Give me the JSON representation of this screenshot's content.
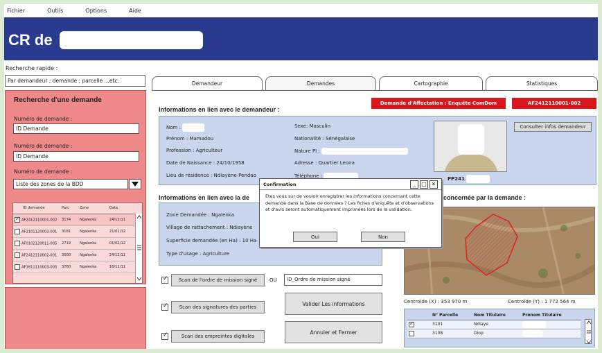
{
  "menu": [
    "Fichier",
    "Outils",
    "Options",
    "Aide"
  ],
  "header": {
    "title": "CR de"
  },
  "quick_search": {
    "label": "Recherche rapide :",
    "value": "Par demandeur ; demande ; parcelle ...etc."
  },
  "left": {
    "title": "Recherche d'une demande",
    "field1_label": "Numéro de demande :",
    "field1_value": "ID Demande",
    "field2_label": "Numéro de demande :",
    "field2_value": "ID Demande",
    "field3_label": "Numéro de demande :",
    "field3_value": "Liste des zones de la BDD",
    "grid_headers": [
      "ID demande",
      "Parc",
      "Zone",
      "Date"
    ],
    "grid_rows": [
      {
        "id": "AF2412110001-002",
        "parc": "3174",
        "zone": "Ngalenka",
        "date": "24/12/11",
        "checked": true
      },
      {
        "id": "AF2101120003-001",
        "parc": "3181",
        "zone": "Ngalenka",
        "date": "21/01/12",
        "checked": false
      },
      {
        "id": "AF0102120011-005",
        "parc": "2719",
        "zone": "Ngalenka",
        "date": "01/02/12",
        "checked": false
      },
      {
        "id": "AF2412110002-001",
        "parc": "3000",
        "zone": "Ngalenka",
        "date": "24/12/11",
        "checked": false
      },
      {
        "id": "AF1611110003-005",
        "parc": "3760",
        "zone": "Ngalenka",
        "date": "16/11/11",
        "checked": false
      }
    ]
  },
  "tabs": [
    "Demandeur",
    "Demandes",
    "Cartographie",
    "Statistiques"
  ],
  "badges": {
    "type": "Demande d'Affectation : Enquête ComDom",
    "id": "AF2412110001-002"
  },
  "demandeur": {
    "section_title": "Informations en lien avec le demandeur :",
    "nom": "Nom :",
    "prenom": "Prénom : Mamadou",
    "profession": "Profession : Agriculteur",
    "naissance": "Date de Naissance : 24/10/1958",
    "residence": "Lieu de résidence : Ndiayène-Pendao",
    "sexe": "Sexe: Masculin",
    "nationalite": "Nationalité : Sénégalaise",
    "nature_pi": "Nature PI :",
    "adresse": "Adresse : Quartier Leona",
    "telephone": "Téléphone :",
    "photo_id": "PP241",
    "consult_btn": "Consulter infos demandeur"
  },
  "demande": {
    "section_title": "Informations en lien avec la de",
    "parcelle_title": "concernée par la demande :",
    "zone": "Zone Demandée : Ngalenka",
    "village": "Village de rattachement : Ndiayène",
    "superficie": "Superficie demandée (en Ha) : 10 Ha",
    "usage": "Type d'usage : Agriculture"
  },
  "scans": {
    "btn1": "Scan de l'ordre de mission signé",
    "or": "OU",
    "field1": "ID_Ordre de mission signé",
    "btn2": "Scan des signatures des parties",
    "btn3": "Scan des empreintes digitales",
    "validate": "Valider Les informations",
    "cancel": "Annuler et Fermer"
  },
  "map": {
    "centroid_x": "Centroïde (X) : 353 970 m",
    "centroid_y": "Centroïde (Y) : 1 772 564 m"
  },
  "parcel_table": {
    "headers": [
      "N° Parcelle",
      "Nom Titulaire",
      "Prénom Titulaire"
    ],
    "rows": [
      {
        "num": "3101",
        "nom": "Ndiaye",
        "checked": true
      },
      {
        "num": "3108",
        "nom": "Diop",
        "checked": false
      }
    ]
  },
  "dialog": {
    "title": "Confirmation",
    "text": "Etes vous sur de vouloir enregistrer les informations concernant cette demande dans la Base de données ? Les fiches d'enquête et d'observations et d'avis seront automatiquement imprimées lors de la validation.",
    "yes": "Oui",
    "no": "Non"
  },
  "colors": {
    "header_bg": "#2a3a8e",
    "left_panel": "#f08a8a",
    "info_panel": "#c9d6ee",
    "badge_red": "#d9161c"
  }
}
